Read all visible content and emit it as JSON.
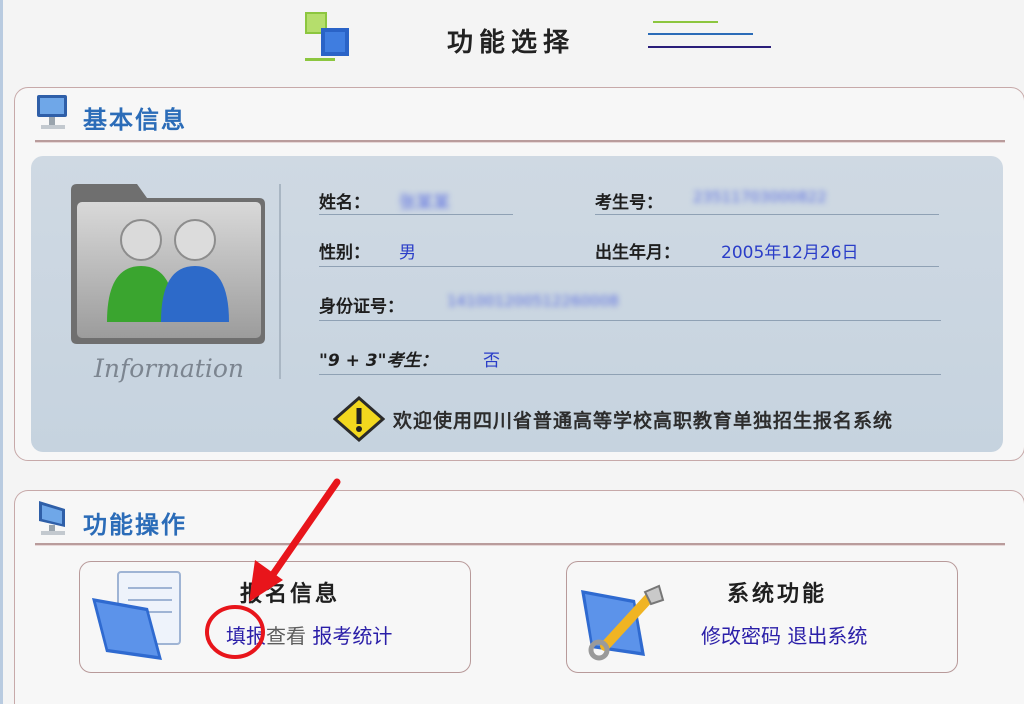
{
  "header": {
    "title": "功能选择"
  },
  "basic_info": {
    "section_title": "基本信息",
    "caption": "Information",
    "fields": {
      "name_label": "姓名：",
      "name_value": "张某某",
      "exam_no_label": "考生号：",
      "exam_no_value": "23511703000822",
      "gender_label": "性别：",
      "gender_value": "男",
      "birth_label": "出生年月：",
      "birth_value": "2005年12月26日",
      "id_label": "身份证号：",
      "id_value": "141001200512260008",
      "nine3_label": "\"9 + 3\"考生：",
      "nine3_value": "否"
    },
    "welcome": "欢迎使用四川省普通高等学校高职教育单独招生报名系统"
  },
  "functions": {
    "section_title": "功能操作",
    "register": {
      "title": "报名信息",
      "fill_link": "填报",
      "view_link": "查看",
      "stats_link": "报考统计"
    },
    "system": {
      "title": "系统功能",
      "change_pwd_link": "修改密码",
      "logout_link": "退出系统"
    }
  },
  "colors": {
    "accent_blue": "#2b6cb8",
    "link": "#2a1ea8",
    "value_text": "#2a3dc8",
    "annotation_red": "#e8151b"
  }
}
